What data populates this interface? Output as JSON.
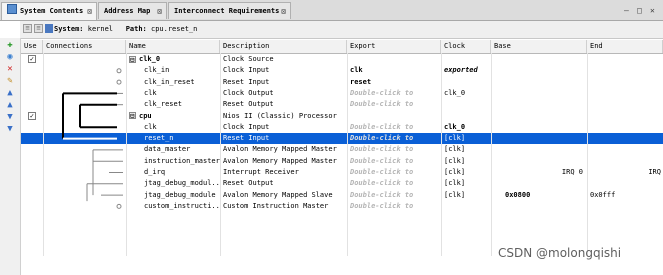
{
  "tabs": [
    {
      "label": "System Contents",
      "close": "⊠",
      "active": true
    },
    {
      "label": "Address Map",
      "close": "⊠",
      "active": false
    },
    {
      "label": "Interconnect Requirements",
      "close": "⊠",
      "active": false
    }
  ],
  "window_controls": {
    "minimize": "—",
    "restore": "□",
    "close": "✕"
  },
  "toolbar": {
    "system_label": "System:",
    "system_value": "kernel",
    "path_label": "Path:",
    "path_value": "cpu.reset_n",
    "btn_up": "≡",
    "btn_down": "≡",
    "btn_sys": "▪"
  },
  "sidebar_icons": [
    {
      "name": "add-icon",
      "glyph": "✚",
      "color": "#2a9a2a"
    },
    {
      "name": "component-icon",
      "glyph": "◉",
      "color": "#3a7fd0"
    },
    {
      "name": "remove-icon",
      "glyph": "✕",
      "color": "#d02020"
    },
    {
      "name": "edit-icon",
      "glyph": "✎",
      "color": "#c08a20"
    },
    {
      "name": "move-top-icon",
      "glyph": "▲",
      "color": "#3a70c8"
    },
    {
      "name": "move-up-icon",
      "glyph": "▲",
      "color": "#3a70c8"
    },
    {
      "name": "move-down-icon",
      "glyph": "▼",
      "color": "#3a70c8"
    },
    {
      "name": "move-bottom-icon",
      "glyph": "▼",
      "color": "#3a70c8"
    }
  ],
  "columns": [
    "Use",
    "Connections",
    "Name",
    "Description",
    "Export",
    "Clock",
    "Base",
    "End"
  ],
  "rows": [
    {
      "use": "✓",
      "name": "clk_0",
      "toggle": "⊟",
      "description": "Clock Source",
      "export": "",
      "clock": "",
      "base": "",
      "end": ""
    },
    {
      "use": "",
      "name": "clk_in",
      "description": "Clock Input",
      "export": "clk",
      "clock": "exported",
      "base": "",
      "end": ""
    },
    {
      "use": "",
      "name": "clk_in_reset",
      "description": "Reset Input",
      "export": "reset",
      "clock": "",
      "base": "",
      "end": ""
    },
    {
      "use": "",
      "name": "clk",
      "description": "Clock Output",
      "export": "Double-click to",
      "clock": "clk_0",
      "base": "",
      "end": ""
    },
    {
      "use": "",
      "name": "clk_reset",
      "description": "Reset Output",
      "export": "Double-click to",
      "clock": "",
      "base": "",
      "end": ""
    },
    {
      "use": "✓",
      "name": "cpu",
      "toggle": "⊟",
      "description": "Nios II (Classic) Processor",
      "export": "",
      "clock": "",
      "base": "",
      "end": ""
    },
    {
      "use": "",
      "name": "clk",
      "description": "Clock Input",
      "export": "Double-click to",
      "clock": "clk_0",
      "base": "",
      "end": ""
    },
    {
      "use": "",
      "name": "reset_n",
      "description": "Reset Input",
      "export": "Double-click to",
      "clock": "[clk]",
      "base": "",
      "end": ""
    },
    {
      "use": "",
      "name": "data_master",
      "description": "Avalon Memory Mapped Master",
      "export": "Double-click to",
      "clock": "[clk]",
      "base": "",
      "end": ""
    },
    {
      "use": "",
      "name": "instruction_master",
      "description": "Avalon Memory Mapped Master",
      "export": "Double-click to",
      "clock": "[clk]",
      "base": "",
      "end": ""
    },
    {
      "use": "",
      "name": "d_irq",
      "description": "Interrupt Receiver",
      "export": "Double-click to",
      "clock": "[clk]",
      "base": "IRQ 0",
      "end": "IRQ"
    },
    {
      "use": "",
      "name": "jtag_debug_modul...",
      "description": "Reset Output",
      "export": "Double-click to",
      "clock": "[clk]",
      "base": "",
      "end": ""
    },
    {
      "use": "",
      "name": "jtag_debug_module",
      "description": "Avalon Memory Mapped Slave",
      "export": "Double-click to",
      "clock": "[clk]",
      "base": "0x0800",
      "end": "0x0fff"
    },
    {
      "use": "",
      "name": "custom_instructi...",
      "description": "Custom Instruction Master",
      "export": "Double-click to",
      "clock": "",
      "base": "",
      "end": ""
    }
  ],
  "selected_row_index": 7,
  "watermark": "CSDN @molongqishi"
}
